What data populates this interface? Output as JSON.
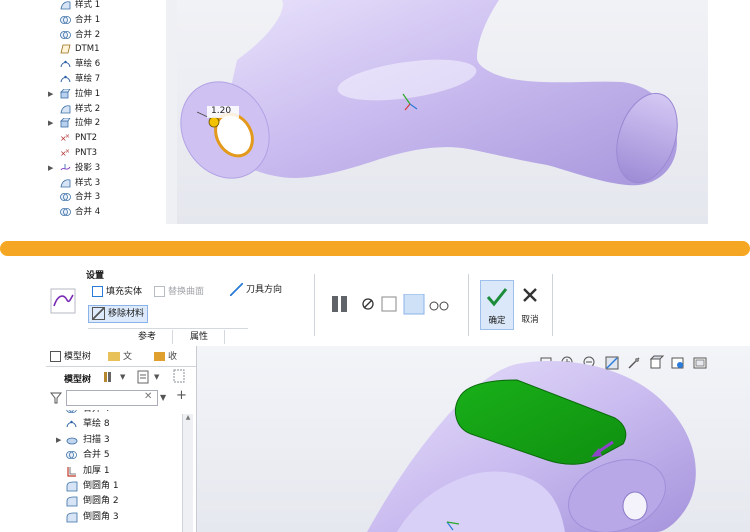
{
  "top_tree": {
    "items": [
      {
        "label": "样式 1",
        "icon": "style-icon",
        "expand": ""
      },
      {
        "label": "合并 1",
        "icon": "merge-icon",
        "expand": ""
      },
      {
        "label": "合并 2",
        "icon": "merge-icon",
        "expand": ""
      },
      {
        "label": "DTM1",
        "icon": "datum-plane-icon",
        "expand": ""
      },
      {
        "label": "草绘 6",
        "icon": "sketch-icon",
        "expand": ""
      },
      {
        "label": "草绘 7",
        "icon": "sketch-icon",
        "expand": ""
      },
      {
        "label": "拉伸 1",
        "icon": "extrude-icon",
        "expand": "▶"
      },
      {
        "label": "样式 2",
        "icon": "style-icon",
        "expand": ""
      },
      {
        "label": "拉伸 2",
        "icon": "extrude-icon",
        "expand": "▶"
      },
      {
        "label": "PNT2",
        "icon": "datum-point-icon",
        "expand": ""
      },
      {
        "label": "PNT3",
        "icon": "datum-point-icon",
        "expand": ""
      },
      {
        "label": "投影 3",
        "icon": "project-icon",
        "expand": "▶"
      },
      {
        "label": "样式 3",
        "icon": "style-icon",
        "expand": ""
      },
      {
        "label": "合并 3",
        "icon": "merge-icon",
        "expand": ""
      },
      {
        "label": "合并 4",
        "icon": "merge-icon",
        "expand": ""
      }
    ]
  },
  "top_viewport": {
    "dimension_label": "1.20"
  },
  "ribbon": {
    "group_title": "设置",
    "fill_solid": "填充实体",
    "replace_surface": "替换曲面",
    "tool_direction": "刀具方向",
    "remove_material": "移除材料",
    "tab_reference": "参考",
    "tab_properties": "属性",
    "ok_label": "确定",
    "cancel_label": "取消"
  },
  "left_pane": {
    "tab_model_tree": "模型树",
    "tab_file": "文",
    "tab_favorites": "收",
    "tree_header": "模型树",
    "search_placeholder": "",
    "items": [
      {
        "label": "合并 4",
        "icon": "merge-icon",
        "expand": ""
      },
      {
        "label": "草绘 8",
        "icon": "sketch-icon",
        "expand": ""
      },
      {
        "label": "扫描 3",
        "icon": "sweep-icon",
        "expand": "▶"
      },
      {
        "label": "合并 5",
        "icon": "merge-icon",
        "expand": ""
      },
      {
        "label": "加厚 1",
        "icon": "thicken-icon",
        "expand": ""
      },
      {
        "label": "倒圆角 1",
        "icon": "round-icon",
        "expand": ""
      },
      {
        "label": "倒圆角 2",
        "icon": "round-icon",
        "expand": ""
      },
      {
        "label": "倒圆角 3",
        "icon": "round-icon",
        "expand": ""
      }
    ]
  },
  "colors": {
    "separator": "#f5a623",
    "model": "#cdbff0",
    "selected_face": "#15a315",
    "accent": "#2b7bd8"
  }
}
